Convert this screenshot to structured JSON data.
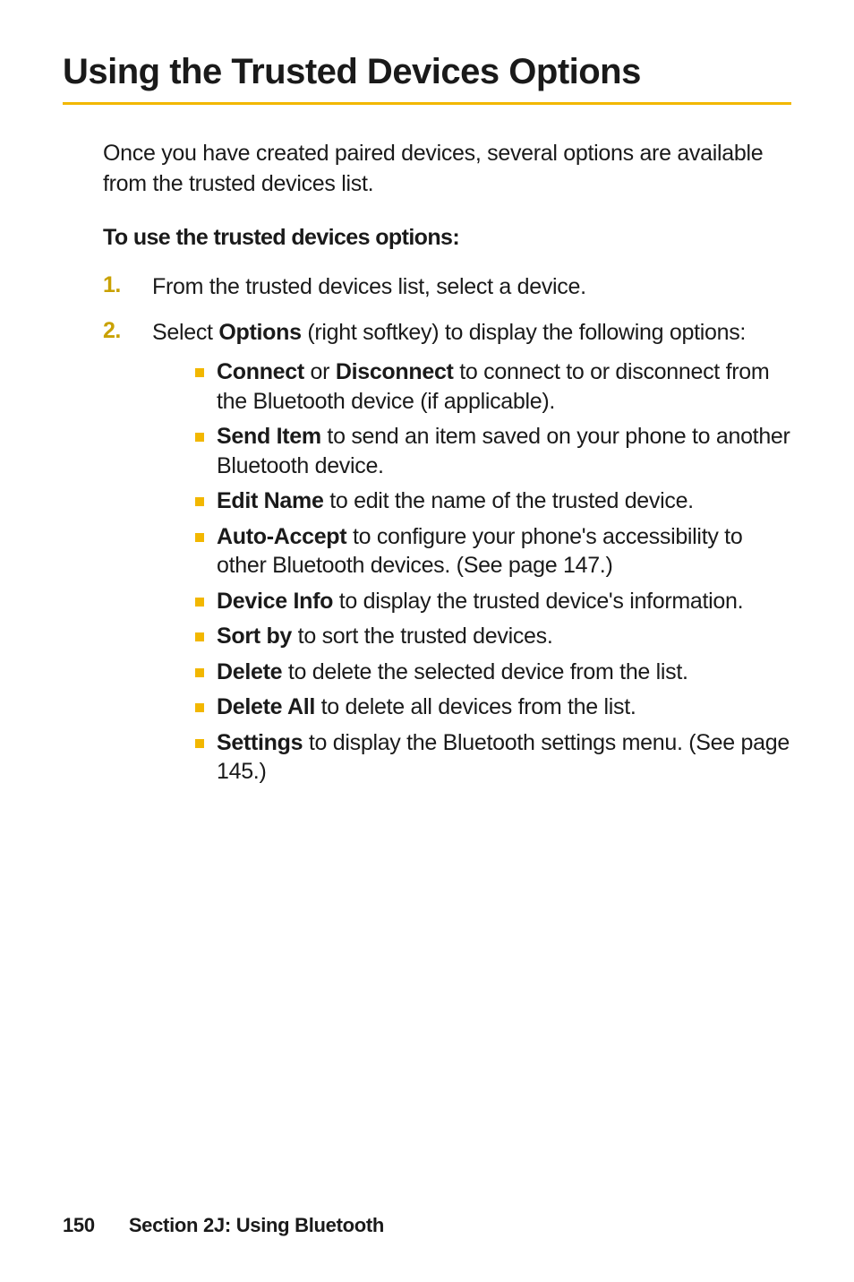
{
  "heading": "Using the Trusted Devices Options",
  "intro": "Once you have created paired devices, several options are available from the trusted devices list.",
  "subhead": "To use the trusted devices options:",
  "steps": [
    {
      "num": "1.",
      "text": "From the trusted devices list, select a device."
    },
    {
      "num": "2.",
      "pre": "Select ",
      "bold": "Options",
      "post": " (right softkey) to display the following options:"
    }
  ],
  "options": [
    {
      "b1": "Connect",
      "mid": " or ",
      "b2": "Disconnect",
      "rest": " to connect to or disconnect from the Bluetooth device (if applicable)."
    },
    {
      "b1": "Send Item",
      "rest": " to send an item saved on your phone to another Bluetooth device."
    },
    {
      "b1": "Edit Name",
      "rest": " to edit the name of the trusted device."
    },
    {
      "b1": "Auto-Accept",
      "rest": " to configure your phone's accessibility to other Bluetooth devices. (See page 147.)"
    },
    {
      "b1": "Device Info",
      "rest": " to display the trusted device's information."
    },
    {
      "b1": "Sort by",
      "rest": " to sort the trusted devices."
    },
    {
      "b1": "Delete",
      "rest": " to delete the selected device from the list."
    },
    {
      "b1": "Delete All",
      "rest": " to delete all devices from the list."
    },
    {
      "b1": "Settings",
      "rest": " to display the Bluetooth settings menu. (See page 145.)"
    }
  ],
  "footer": {
    "page": "150",
    "section": "Section 2J: Using Bluetooth"
  }
}
